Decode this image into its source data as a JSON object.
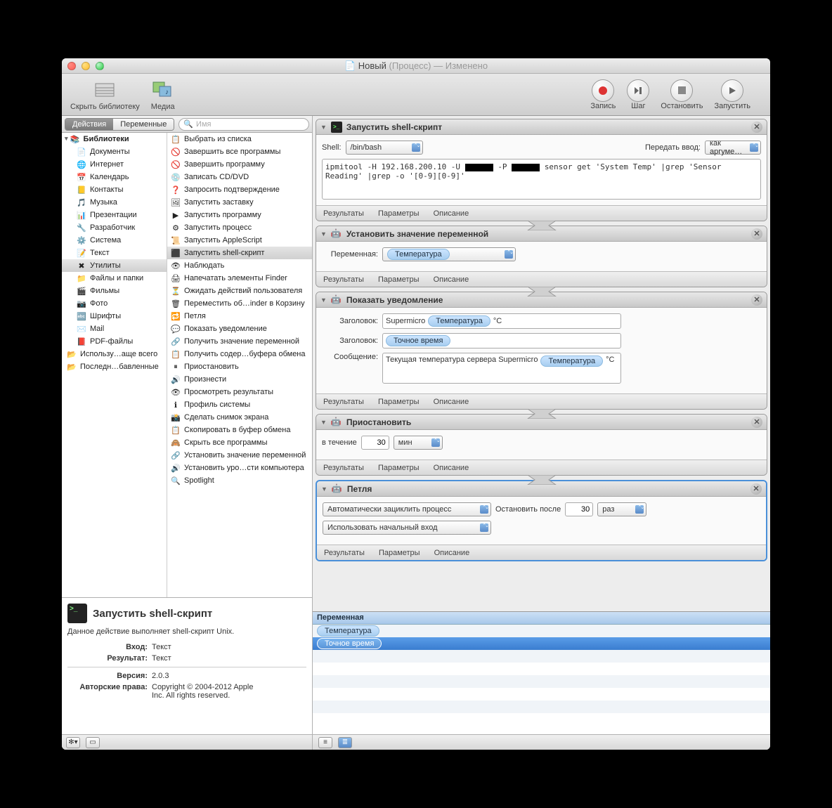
{
  "window": {
    "docicon": "📄",
    "title_main": "Новый",
    "title_suffix": "(Процесс)",
    "title_status": "— Изменено"
  },
  "toolbar": {
    "hide_library": "Скрыть библиотеку",
    "media": "Медиа",
    "record": "Запись",
    "step": "Шаг",
    "stop": "Остановить",
    "run": "Запустить"
  },
  "tabs": {
    "actions": "Действия",
    "variables": "Переменные"
  },
  "search": {
    "placeholder": "Имя"
  },
  "library": {
    "header": "Библиотеки",
    "items": [
      {
        "icon": "📄",
        "label": "Документы"
      },
      {
        "icon": "🌐",
        "label": "Интернет"
      },
      {
        "icon": "📅",
        "label": "Календарь"
      },
      {
        "icon": "📒",
        "label": "Контакты"
      },
      {
        "icon": "🎵",
        "label": "Музыка"
      },
      {
        "icon": "📊",
        "label": "Презентации"
      },
      {
        "icon": "🔧",
        "label": "Разработчик"
      },
      {
        "icon": "⚙️",
        "label": "Система"
      },
      {
        "icon": "📝",
        "label": "Текст"
      },
      {
        "icon": "✖",
        "label": "Утилиты"
      },
      {
        "icon": "📁",
        "label": "Файлы и папки"
      },
      {
        "icon": "🎬",
        "label": "Фильмы"
      },
      {
        "icon": "📷",
        "label": "Фото"
      },
      {
        "icon": "🔤",
        "label": "Шрифты"
      },
      {
        "icon": "✉️",
        "label": "Mail"
      },
      {
        "icon": "📕",
        "label": "PDF-файлы"
      }
    ],
    "extra": [
      {
        "icon": "📂",
        "label": "Использу…аще всего"
      },
      {
        "icon": "📂",
        "label": "Последн…бавленные"
      }
    ]
  },
  "actions_list": [
    {
      "icon": "📋",
      "label": "Выбрать из списка"
    },
    {
      "icon": "🚫",
      "label": "Завершить все программы"
    },
    {
      "icon": "🚫",
      "label": "Завершить программу"
    },
    {
      "icon": "💿",
      "label": "Записать CD/DVD"
    },
    {
      "icon": "❓",
      "label": "Запросить подтверждение"
    },
    {
      "icon": "🖼",
      "label": "Запустить заставку"
    },
    {
      "icon": "▶",
      "label": "Запустить программу"
    },
    {
      "icon": "⚙",
      "label": "Запустить процесс"
    },
    {
      "icon": "📜",
      "label": "Запустить AppleScript"
    },
    {
      "icon": "⬛",
      "label": "Запустить shell-скрипт"
    },
    {
      "icon": "👁",
      "label": "Наблюдать"
    },
    {
      "icon": "🖨",
      "label": "Напечатать элементы Finder"
    },
    {
      "icon": "⏳",
      "label": "Ожидать действий пользователя"
    },
    {
      "icon": "🗑",
      "label": "Переместить об…inder в Корзину"
    },
    {
      "icon": "🔁",
      "label": "Петля"
    },
    {
      "icon": "💬",
      "label": "Показать уведомление"
    },
    {
      "icon": "🔗",
      "label": "Получить значение переменной"
    },
    {
      "icon": "📋",
      "label": "Получить содер…буфера обмена"
    },
    {
      "icon": "⏸",
      "label": "Приостановить"
    },
    {
      "icon": "🔊",
      "label": "Произнести"
    },
    {
      "icon": "👁",
      "label": "Просмотреть результаты"
    },
    {
      "icon": "ℹ",
      "label": "Профиль системы"
    },
    {
      "icon": "📸",
      "label": "Сделать снимок экрана"
    },
    {
      "icon": "📋",
      "label": "Скопировать в буфер обмена"
    },
    {
      "icon": "🙈",
      "label": "Скрыть все программы"
    },
    {
      "icon": "🔗",
      "label": "Установить значение переменной"
    },
    {
      "icon": "🔊",
      "label": "Установить уро…сти компьютера"
    },
    {
      "icon": "🔍",
      "label": "Spotlight"
    }
  ],
  "description": {
    "title": "Запустить shell-скрипт",
    "text": "Данное действие выполняет shell-скрипт Unix.",
    "rows": {
      "input_k": "Вход:",
      "input_v": "Текст",
      "result_k": "Результат:",
      "result_v": "Текст",
      "version_k": "Версия:",
      "version_v": "2.0.3",
      "copyright_k": "Авторские права:",
      "copyright_v": "Copyright © 2004-2012 Apple Inc.  All rights reserved."
    }
  },
  "workflow": {
    "a1": {
      "title": "Запустить shell-скрипт",
      "shell_label": "Shell:",
      "shell_value": "/bin/bash",
      "pass_label": "Передать ввод:",
      "pass_value": "как аргуме…",
      "script_pre": "ipmitool -H 192.168.200.10 -U",
      "script_mid": "-P",
      "script_post": "sensor get 'System Temp' |grep 'Sensor Reading'  |grep -o '[0-9][0-9]'"
    },
    "a2": {
      "title": "Установить значение переменной",
      "var_label": "Переменная:",
      "var_value": "Температура"
    },
    "a3": {
      "title": "Показать уведомление",
      "hdr1_label": "Заголовок:",
      "hdr1_text": "Supermicro",
      "hdr1_token": "Температура",
      "hdr1_suffix": "°C",
      "hdr2_label": "Заголовок:",
      "hdr2_token": "Точное время",
      "msg_label": "Сообщение:",
      "msg_text": "Текущая температура сервера Supermicro",
      "msg_token": "Температура",
      "msg_suffix": "°C"
    },
    "a4": {
      "title": "Приостановить",
      "for_label": "в течение",
      "value": "30",
      "unit": "мин"
    },
    "a5": {
      "title": "Петля",
      "mode": "Автоматически зациклить процесс",
      "stop_label": "Остановить после",
      "stop_value": "30",
      "stop_unit": "раз",
      "input_mode": "Использовать начальный вход"
    },
    "footer": {
      "results": "Результаты",
      "params": "Параметры",
      "desc": "Описание"
    }
  },
  "variables": {
    "header": "Переменная",
    "rows": [
      "Температура",
      "Точное время"
    ]
  }
}
